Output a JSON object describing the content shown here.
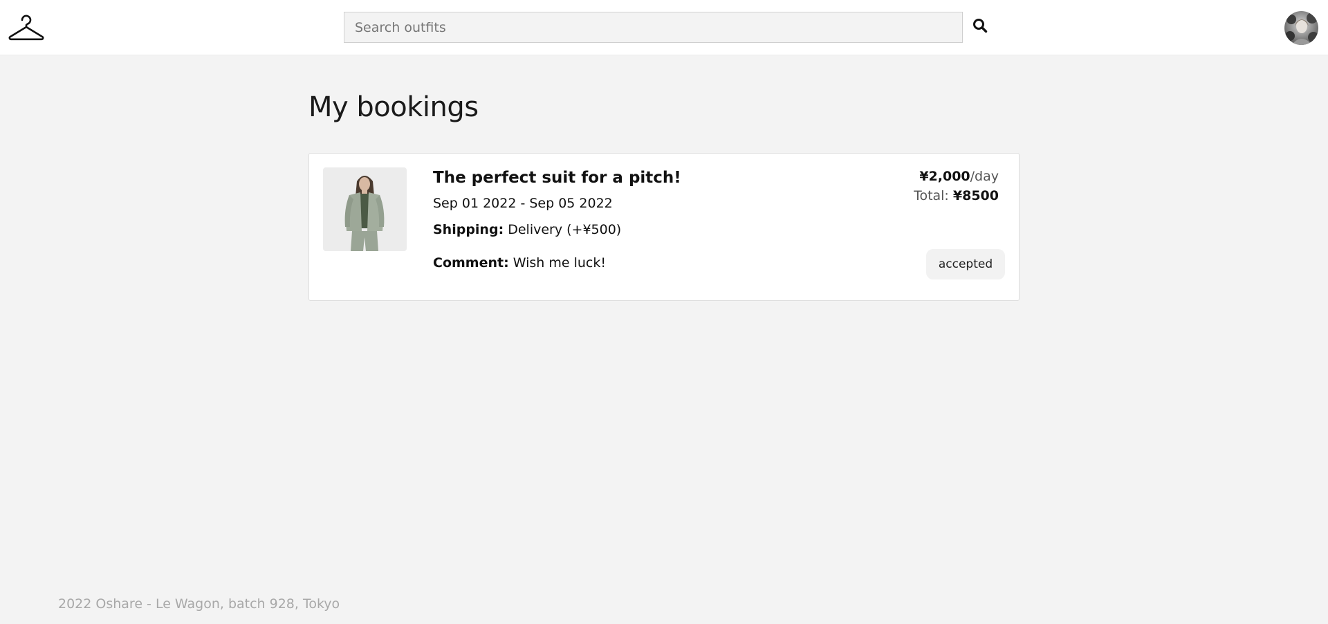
{
  "navbar": {
    "logo_icon": "hanger-icon",
    "search": {
      "placeholder": "Search outfits",
      "value": ""
    },
    "search_icon": "search-icon",
    "avatar": "user-avatar"
  },
  "main": {
    "title": "My bookings",
    "bookings": [
      {
        "title": "The perfect suit for a pitch!",
        "dates": "Sep 01 2022 - Sep 05 2022",
        "shipping_label": "Shipping:",
        "shipping_value": "Delivery (+¥500)",
        "comment_label": "Comment:",
        "comment_value": "Wish me luck!",
        "price": "¥2,000",
        "price_unit": "/day",
        "total_label": "Total:",
        "total_value": "¥8500",
        "status": "accepted"
      }
    ]
  },
  "footer": {
    "text": "2022 Oshare - Le Wagon, batch 928, Tokyo"
  },
  "colors": {
    "background": "#f3f3f3",
    "card": "#ffffff",
    "badge": "#f2f2f2"
  }
}
